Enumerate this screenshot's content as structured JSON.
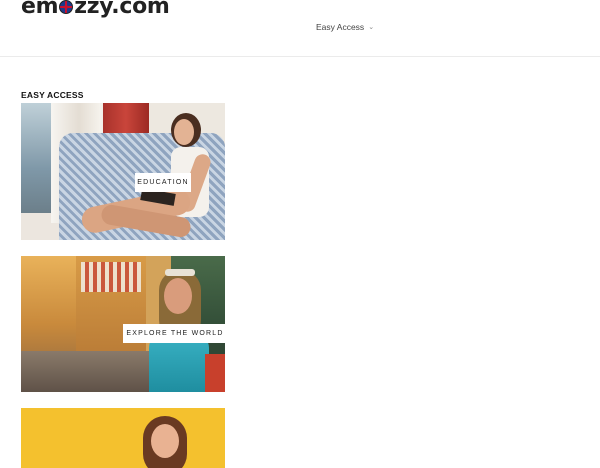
{
  "header": {
    "logo": {
      "prefix": "em",
      "suffix": "zzy.com"
    },
    "nav": {
      "label": "Easy Access"
    }
  },
  "section": {
    "title": "EASY ACCESS"
  },
  "cards": [
    {
      "label": "EDUCATION"
    },
    {
      "label": "EXPLORE THE WORLD"
    },
    {
      "label": ""
    }
  ],
  "colors": {
    "text": "#222222",
    "divider": "#ebebeb",
    "background": "#ffffff"
  },
  "icons": {
    "nav_dropdown": "chevron-down-icon",
    "logo_flag": "flag-icon"
  }
}
